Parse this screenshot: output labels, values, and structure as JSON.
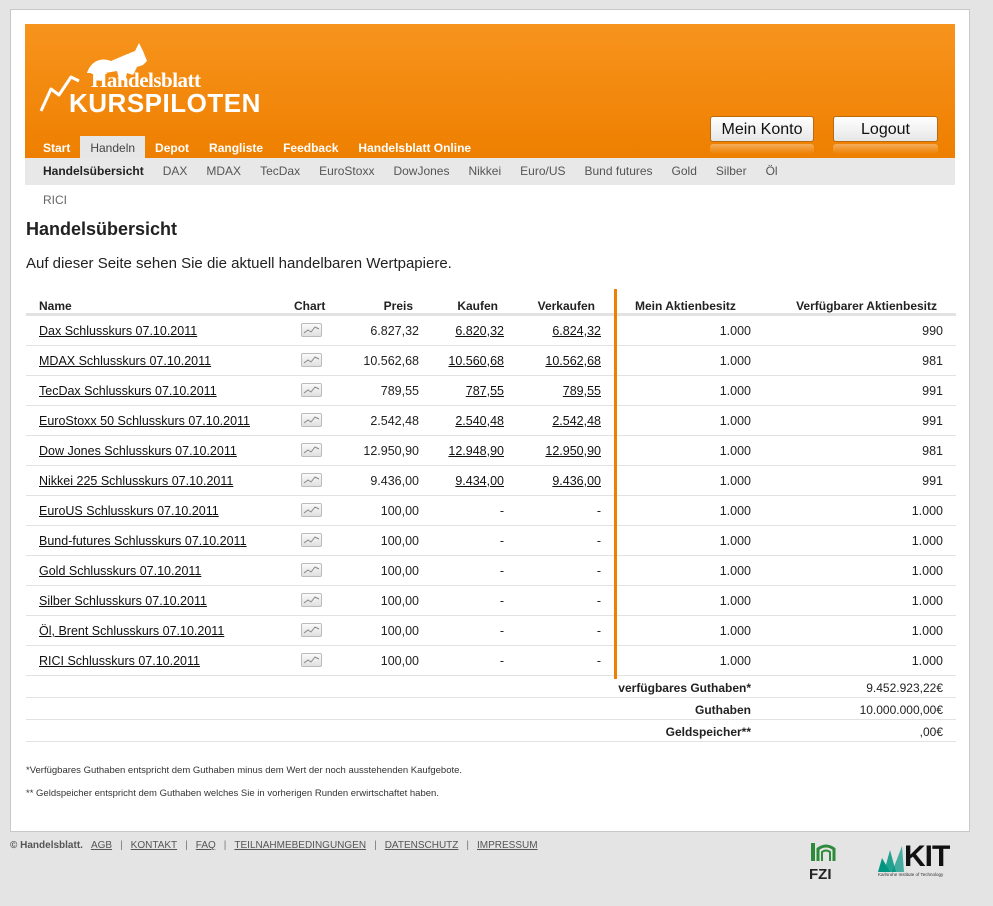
{
  "brand": {
    "line1": "Handelsblatt",
    "line2": "KURSPILOTEN"
  },
  "header_buttons": {
    "account": "Mein Konto",
    "logout": "Logout"
  },
  "nav": [
    "Start",
    "Handeln",
    "Depot",
    "Rangliste",
    "Feedback",
    "Handelsblatt Online"
  ],
  "nav_active": "Handeln",
  "subnav": [
    "Handelsübersicht",
    "DAX",
    "MDAX",
    "TecDax",
    "EuroStoxx",
    "DowJones",
    "Nikkei",
    "Euro/US",
    "Bund futures",
    "Gold",
    "Silber",
    "Öl"
  ],
  "subnav_extra": "RICI",
  "page": {
    "title": "Handelsübersicht",
    "description": "Auf dieser Seite sehen Sie die aktuell handelbaren Wertpapiere."
  },
  "table": {
    "headers": {
      "name": "Name",
      "chart": "Chart",
      "price": "Preis",
      "buy": "Kaufen",
      "sell": "Verkaufen",
      "own": "Mein Aktienbesitz",
      "available": "Verfügbarer Aktienbesitz"
    },
    "rows": [
      {
        "name": "Dax Schlusskurs 07.10.2011",
        "price": "6.827,32",
        "buy": "6.820,32",
        "sell": "6.824,32",
        "own": "1.000",
        "available": "990"
      },
      {
        "name": "MDAX Schlusskurs 07.10.2011",
        "price": "10.562,68",
        "buy": "10.560,68",
        "sell": "10.562,68",
        "own": "1.000",
        "available": "981"
      },
      {
        "name": "TecDax Schlusskurs 07.10.2011",
        "price": "789,55",
        "buy": "787,55",
        "sell": "789,55",
        "own": "1.000",
        "available": "991"
      },
      {
        "name": "EuroStoxx 50 Schlusskurs 07.10.2011",
        "price": "2.542,48",
        "buy": "2.540,48",
        "sell": "2.542,48",
        "own": "1.000",
        "available": "991"
      },
      {
        "name": "Dow Jones Schlusskurs 07.10.2011",
        "price": "12.950,90",
        "buy": "12.948,90",
        "sell": "12.950,90",
        "own": "1.000",
        "available": "981"
      },
      {
        "name": "Nikkei 225 Schlusskurs 07.10.2011",
        "price": "9.436,00",
        "buy": "9.434,00",
        "sell": "9.436,00",
        "own": "1.000",
        "available": "991"
      },
      {
        "name": "EuroUS Schlusskurs 07.10.2011",
        "price": "100,00",
        "buy": "-",
        "sell": "-",
        "own": "1.000",
        "available": "1.000"
      },
      {
        "name": "Bund-futures Schlusskurs 07.10.2011",
        "price": "100,00",
        "buy": "-",
        "sell": "-",
        "own": "1.000",
        "available": "1.000"
      },
      {
        "name": "Gold Schlusskurs 07.10.2011",
        "price": "100,00",
        "buy": "-",
        "sell": "-",
        "own": "1.000",
        "available": "1.000"
      },
      {
        "name": "Silber Schlusskurs 07.10.2011",
        "price": "100,00",
        "buy": "-",
        "sell": "-",
        "own": "1.000",
        "available": "1.000"
      },
      {
        "name": "Öl, Brent Schlusskurs 07.10.2011",
        "price": "100,00",
        "buy": "-",
        "sell": "-",
        "own": "1.000",
        "available": "1.000"
      },
      {
        "name": "RICI Schlusskurs 07.10.2011",
        "price": "100,00",
        "buy": "-",
        "sell": "-",
        "own": "1.000",
        "available": "1.000"
      }
    ],
    "summary": [
      {
        "label": "verfügbares Guthaben*",
        "value": "9.452.923,22€"
      },
      {
        "label": "Guthaben",
        "value": "10.000.000,00€"
      },
      {
        "label": "Geldspeicher**",
        "value": ",00€"
      }
    ]
  },
  "notes": [
    "*Verfügbares Guthaben entspricht dem Guthaben minus dem Wert der noch ausstehenden Kaufgebote.",
    "** Geldspeicher entspricht dem Guthaben welches Sie in vorherigen Runden erwirtschaftet haben."
  ],
  "footer": {
    "copyright": "© Handelsblatt.",
    "links": [
      "AGB",
      "KONTAKT",
      "FAQ",
      "TEILNAHMEBEDINGUNGEN",
      "DATENSCHUTZ",
      "IMPRESSUM"
    ]
  },
  "logos": {
    "fzi": "FZI",
    "kit": "KIT",
    "kit_sub": "Karlsruhe Institute of Technology"
  },
  "colors": {
    "brand_orange": "#ee7f00",
    "nav_bg": "#e8e8e8"
  }
}
